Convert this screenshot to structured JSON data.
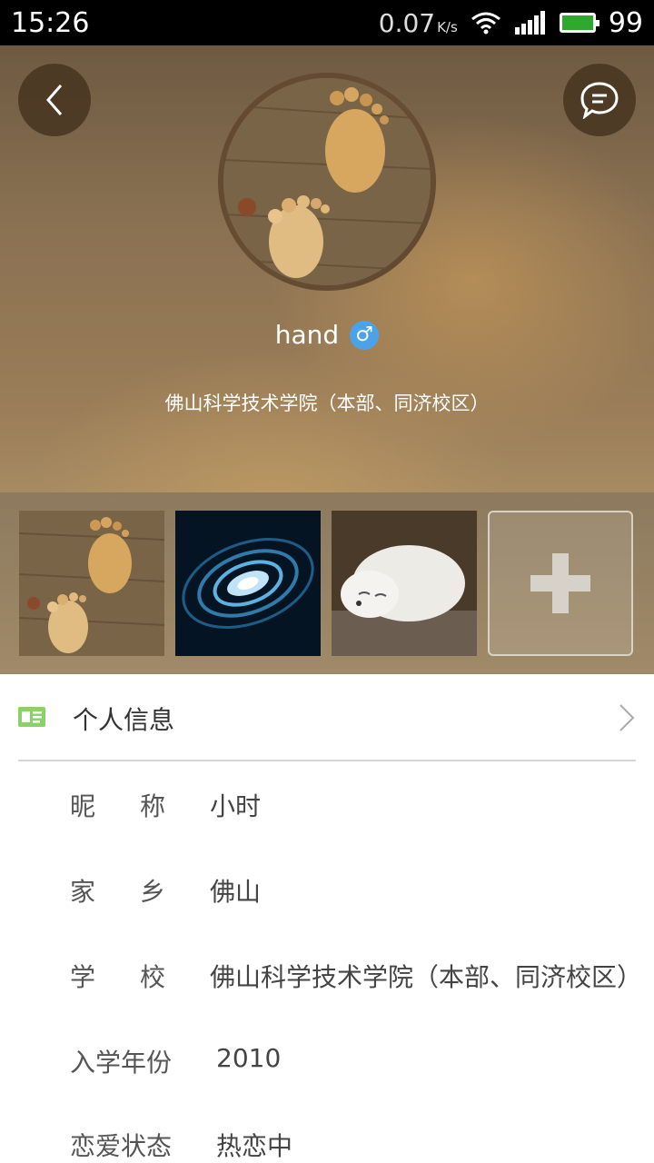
{
  "status_bar": {
    "time": "15:26",
    "net_speed": "0.07",
    "net_unit": "K/s",
    "battery": "99"
  },
  "icons": {
    "back": "back-chevron-icon",
    "chat": "chat-bubble-icon",
    "gender": "male-icon",
    "add_photo": "plus-icon",
    "info": "id-card-icon",
    "chevron": "chevron-right-icon"
  },
  "colors": {
    "accent_gender": "#4aa3e8",
    "info_icon": "#8bd16a",
    "status_bar_bg": "#000000"
  },
  "profile": {
    "username": "hand",
    "gender_symbol": "♂",
    "school": "佛山科学技术学院（本部、同济校区）"
  },
  "info": {
    "title": "个人信息",
    "rows": [
      {
        "label_a": "昵",
        "label_b": "称",
        "value": "小时"
      },
      {
        "label_a": "家",
        "label_b": "乡",
        "value": "佛山"
      },
      {
        "label_a": "学",
        "label_b": "校",
        "value": "佛山科学技术学院（本部、同济校区）"
      },
      {
        "label": "入学年份",
        "value": "2010"
      },
      {
        "label": "恋爱状态",
        "value": "热恋中"
      }
    ]
  }
}
